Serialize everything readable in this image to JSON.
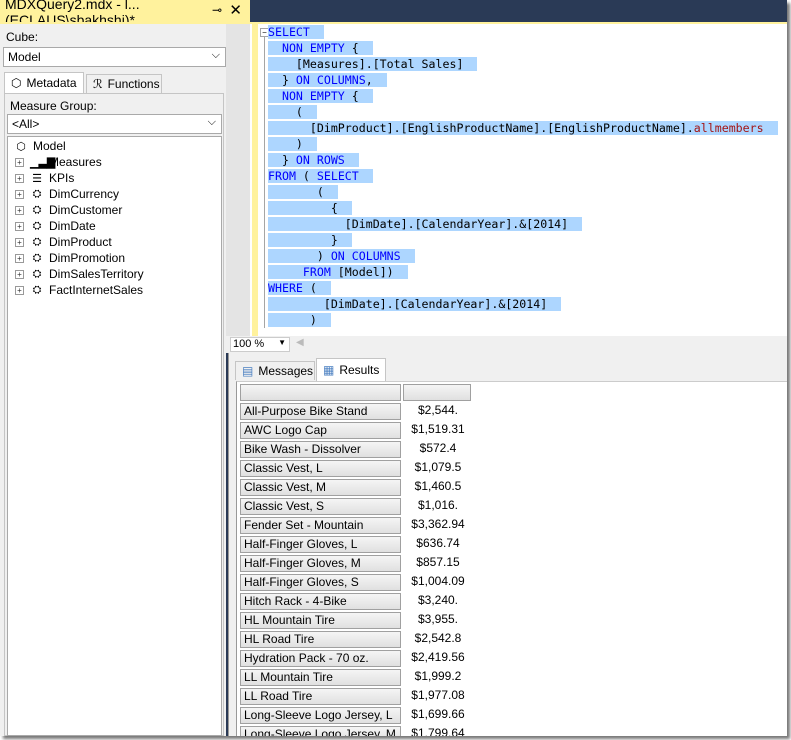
{
  "window": {
    "doc_title": "MDXQuery2.mdx - l...(ECLAUS\\sbakhshi)*",
    "pin_icon": "pin-icon",
    "close_icon": "close-icon"
  },
  "left_panel": {
    "cube_label": "Cube:",
    "cube_value": "Model",
    "tabs": [
      {
        "label": "Metadata",
        "icon": "cube-icon"
      },
      {
        "label": "Functions",
        "icon": "functions-icon"
      }
    ],
    "measure_group_label": "Measure Group:",
    "measure_group_value": "<All>",
    "tree": {
      "root": "Model",
      "items": [
        {
          "label": "Measures",
          "icon": "measures-icon"
        },
        {
          "label": "KPIs",
          "icon": "kpi-icon"
        },
        {
          "label": "DimCurrency",
          "icon": "dimension-icon"
        },
        {
          "label": "DimCustomer",
          "icon": "dimension-icon"
        },
        {
          "label": "DimDate",
          "icon": "dimension-icon"
        },
        {
          "label": "DimProduct",
          "icon": "dimension-icon"
        },
        {
          "label": "DimPromotion",
          "icon": "dimension-icon"
        },
        {
          "label": "DimSalesTerritory",
          "icon": "dimension-icon"
        },
        {
          "label": "FactInternetSales",
          "icon": "dimension-icon"
        }
      ]
    }
  },
  "editor": {
    "lines": [
      [
        [
          "kw",
          "SELECT"
        ]
      ],
      [
        [
          "t",
          "  "
        ],
        [
          "kw",
          "NON EMPTY"
        ],
        [
          "t",
          " {"
        ]
      ],
      [
        [
          "t",
          "    [Measures].[Total Sales]"
        ]
      ],
      [
        [
          "t",
          "  } "
        ],
        [
          "kw",
          "ON COLUMNS"
        ],
        [
          "t",
          ","
        ]
      ],
      [
        [
          "t",
          "  "
        ],
        [
          "kw",
          "NON EMPTY"
        ],
        [
          "t",
          " {"
        ]
      ],
      [
        [
          "t",
          "    ("
        ]
      ],
      [
        [
          "t",
          "      [DimProduct].[EnglishProductName].[EnglishProductName]."
        ],
        [
          "fn",
          "allmembers"
        ]
      ],
      [
        [
          "t",
          "    )"
        ]
      ],
      [
        [
          "t",
          "  } "
        ],
        [
          "kw",
          "ON ROWS"
        ]
      ],
      [
        [
          "kw",
          "FROM"
        ],
        [
          "t",
          " ( "
        ],
        [
          "kw",
          "SELECT"
        ]
      ],
      [
        [
          "t",
          "       ("
        ]
      ],
      [
        [
          "t",
          "         {"
        ]
      ],
      [
        [
          "t",
          "           [DimDate].[CalendarYear].&[2014]"
        ]
      ],
      [
        [
          "t",
          "         }"
        ]
      ],
      [
        [
          "t",
          "       ) "
        ],
        [
          "kw",
          "ON COLUMNS"
        ]
      ],
      [
        [
          "t",
          "     "
        ],
        [
          "kw",
          "FROM"
        ],
        [
          "t",
          " [Model])"
        ]
      ],
      [
        [
          "kw",
          "WHERE"
        ],
        [
          "t",
          " ("
        ]
      ],
      [
        [
          "t",
          "        [DimDate].[CalendarYear].&[2014]"
        ]
      ],
      [
        [
          "t",
          "      )"
        ]
      ]
    ],
    "colors": {
      "keyword": "#0000ff",
      "function": "#a31515",
      "selection": "#add6ff"
    }
  },
  "zoom": {
    "value": "100 %"
  },
  "results": {
    "tabs": [
      {
        "label": "Messages",
        "icon": "messages-icon"
      },
      {
        "label": "Results",
        "icon": "grid-icon"
      }
    ],
    "rows": [
      [
        "All-Purpose Bike Stand",
        "$2,544."
      ],
      [
        "AWC Logo Cap",
        "$1,519.31"
      ],
      [
        "Bike Wash - Dissolver",
        "$572.4"
      ],
      [
        "Classic Vest, L",
        "$1,079.5"
      ],
      [
        "Classic Vest, M",
        "$1,460.5"
      ],
      [
        "Classic Vest, S",
        "$1,016."
      ],
      [
        "Fender Set - Mountain",
        "$3,362.94"
      ],
      [
        "Half-Finger Gloves, L",
        "$636.74"
      ],
      [
        "Half-Finger Gloves, M",
        "$857.15"
      ],
      [
        "Half-Finger Gloves, S",
        "$1,004.09"
      ],
      [
        "Hitch Rack - 4-Bike",
        "$3,240."
      ],
      [
        "HL Mountain Tire",
        "$3,955."
      ],
      [
        "HL Road Tire",
        "$2,542.8"
      ],
      [
        "Hydration Pack - 70 oz.",
        "$2,419.56"
      ],
      [
        "LL Mountain Tire",
        "$1,999.2"
      ],
      [
        "LL Road Tire",
        "$1,977.08"
      ],
      [
        "Long-Sleeve Logo Jersey, L",
        "$1,699.66"
      ],
      [
        "Long-Sleeve Logo Jersey, M",
        "$1,799.64"
      ]
    ]
  }
}
